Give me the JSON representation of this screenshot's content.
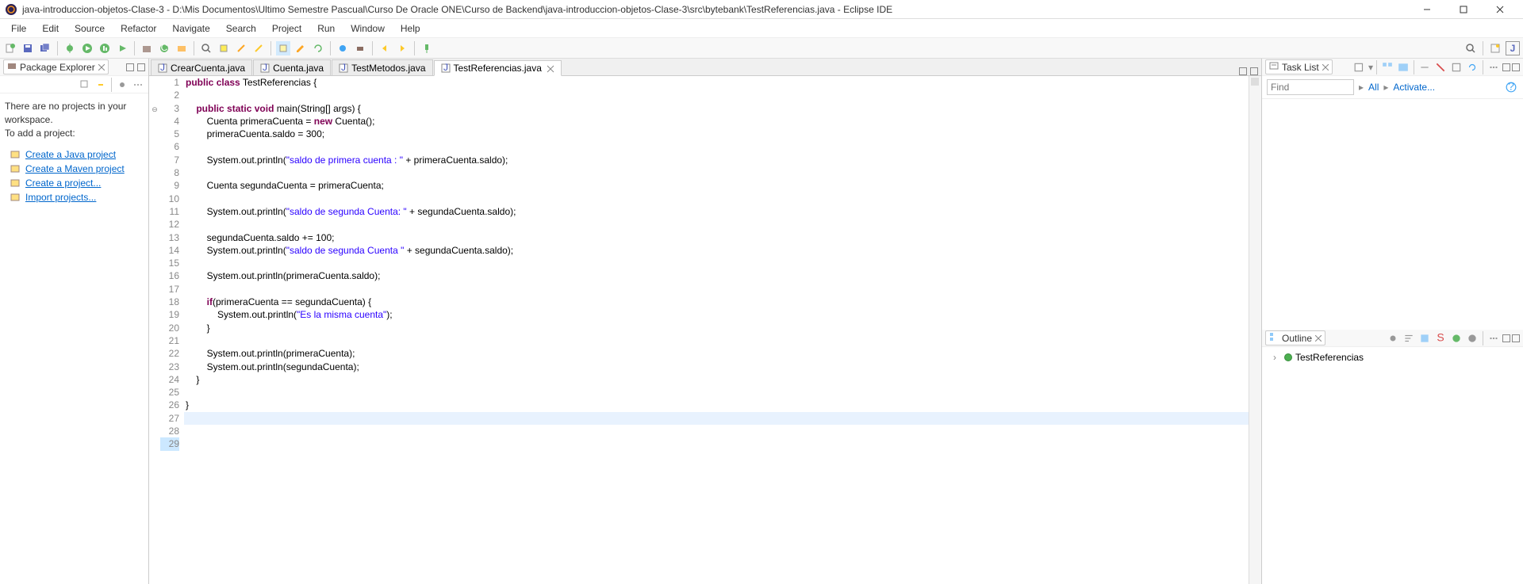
{
  "window": {
    "title": "java-introduccion-objetos-Clase-3 - D:\\Mis Documentos\\Ultimo Semestre Pascual\\Curso De Oracle ONE\\Curso de Backend\\java-introduccion-objetos-Clase-3\\src\\bytebank\\TestReferencias.java - Eclipse IDE"
  },
  "menu": [
    "File",
    "Edit",
    "Source",
    "Refactor",
    "Navigate",
    "Search",
    "Project",
    "Run",
    "Window",
    "Help"
  ],
  "package_explorer": {
    "title": "Package Explorer",
    "message": "There are no projects in your workspace.\nTo add a project:",
    "links": [
      {
        "label": "Create a Java project"
      },
      {
        "label": "Create a Maven project"
      },
      {
        "label": "Create a project..."
      },
      {
        "label": "Import projects..."
      }
    ]
  },
  "editor": {
    "tabs": [
      {
        "label": "CrearCuenta.java",
        "active": false
      },
      {
        "label": "Cuenta.java",
        "active": false
      },
      {
        "label": "TestMetodos.java",
        "active": false
      },
      {
        "label": "TestReferencias.java",
        "active": true
      }
    ],
    "current_line": 27,
    "lines": [
      {
        "n": 1,
        "html": "<span class='kw-purple'>public</span> <span class='kw-purple'>class</span> TestReferencias {"
      },
      {
        "n": 2,
        "html": ""
      },
      {
        "n": 3,
        "html": "    <span class='kw-purple'>public</span> <span class='kw-purple'>static</span> <span class='kw-purple'>void</span> main(String[] args) {",
        "marker": "expand"
      },
      {
        "n": 4,
        "html": "        Cuenta primeraCuenta = <span class='kw-purple'>new</span> Cuenta();"
      },
      {
        "n": 5,
        "html": "        primeraCuenta.saldo = 300;"
      },
      {
        "n": 6,
        "html": ""
      },
      {
        "n": 7,
        "html": "        System.out.println(<span class='kw-str'>\"saldo de primera cuenta : \"</span> + primeraCuenta.saldo);"
      },
      {
        "n": 8,
        "html": ""
      },
      {
        "n": 9,
        "html": "        Cuenta segundaCuenta = primeraCuenta;"
      },
      {
        "n": 10,
        "html": ""
      },
      {
        "n": 11,
        "html": "        System.out.println(<span class='kw-str'>\"saldo de segunda Cuenta: \"</span> + segundaCuenta.saldo);"
      },
      {
        "n": 12,
        "html": ""
      },
      {
        "n": 13,
        "html": "        segundaCuenta.saldo += 100;"
      },
      {
        "n": 14,
        "html": "        System.out.println(<span class='kw-str'>\"saldo de segunda Cuenta \"</span> + segundaCuenta.saldo);"
      },
      {
        "n": 15,
        "html": ""
      },
      {
        "n": 16,
        "html": "        System.out.println(primeraCuenta.saldo);"
      },
      {
        "n": 17,
        "html": ""
      },
      {
        "n": 18,
        "html": "        <span class='kw-purple'>if</span>(primeraCuenta == segundaCuenta) {"
      },
      {
        "n": 19,
        "html": "            System.out.println(<span class='kw-str'>\"Es la misma cuenta\"</span>);"
      },
      {
        "n": 20,
        "html": "        }"
      },
      {
        "n": 21,
        "html": ""
      },
      {
        "n": 22,
        "html": "        System.out.println(primeraCuenta);"
      },
      {
        "n": 23,
        "html": "        System.out.println(segundaCuenta);"
      },
      {
        "n": 24,
        "html": "    }"
      },
      {
        "n": 25,
        "html": ""
      },
      {
        "n": 26,
        "html": "}"
      },
      {
        "n": 27,
        "html": "",
        "current": true
      },
      {
        "n": 28,
        "html": ""
      },
      {
        "n": 29,
        "html": "",
        "highlight": true
      }
    ]
  },
  "task_list": {
    "title": "Task List",
    "find_placeholder": "Find",
    "all_label": "All",
    "activate_label": "Activate..."
  },
  "outline": {
    "title": "Outline",
    "items": [
      {
        "label": "TestReferencias"
      }
    ]
  }
}
